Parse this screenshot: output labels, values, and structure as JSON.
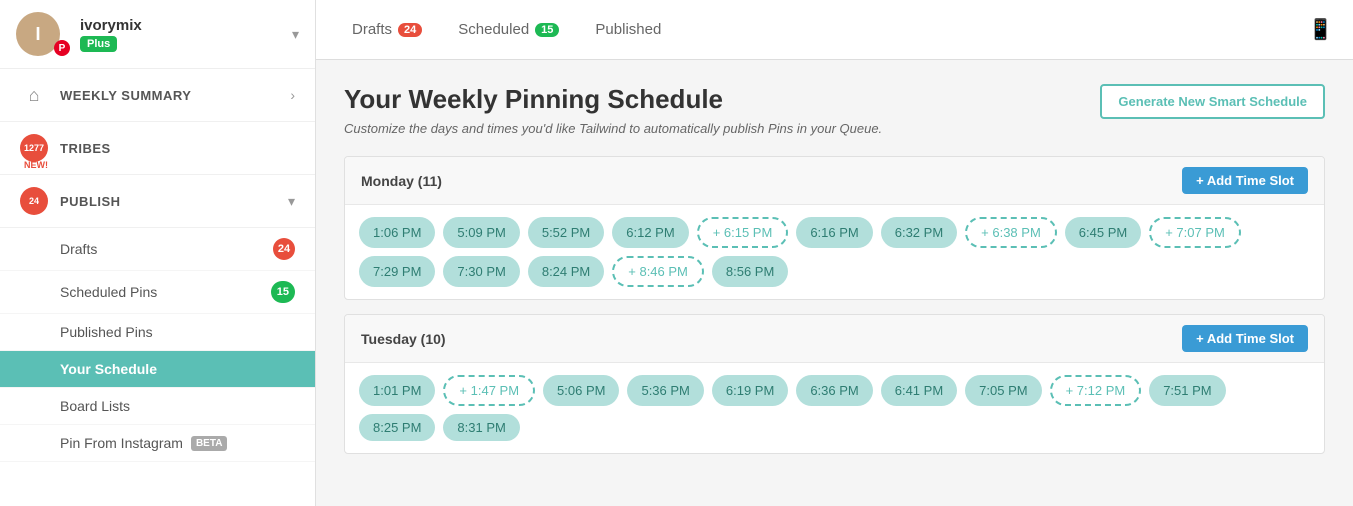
{
  "sidebar": {
    "user": {
      "name": "ivorymix",
      "plus_label": "Plus",
      "initials": "I"
    },
    "nav": [
      {
        "id": "weekly-summary",
        "label": "WEEKLY SUMMARY",
        "icon": "house",
        "badge": null
      },
      {
        "id": "tribes",
        "label": "TRIBES",
        "icon": "tribes-icon",
        "badge": "1277",
        "new": true
      },
      {
        "id": "publish",
        "label": "PUBLISH",
        "icon": "publish-icon",
        "badge": "24",
        "expandable": true
      }
    ],
    "sub_nav": [
      {
        "id": "drafts",
        "label": "Drafts",
        "badge": "24",
        "badge_type": "red"
      },
      {
        "id": "scheduled-pins",
        "label": "Scheduled Pins",
        "badge": "15",
        "badge_type": "green"
      },
      {
        "id": "published-pins",
        "label": "Published Pins",
        "badge": null
      },
      {
        "id": "your-schedule",
        "label": "Your Schedule",
        "active": true,
        "badge": null
      },
      {
        "id": "board-lists",
        "label": "Board Lists",
        "badge": null
      },
      {
        "id": "pin-from-instagram",
        "label": "Pin From Instagram",
        "badge": null,
        "beta": true
      }
    ]
  },
  "tabs": [
    {
      "id": "drafts",
      "label": "Drafts",
      "badge": "24",
      "badge_type": "red"
    },
    {
      "id": "scheduled",
      "label": "Scheduled",
      "badge": "15",
      "badge_type": "green"
    },
    {
      "id": "published",
      "label": "Published",
      "badge": null
    }
  ],
  "schedule": {
    "title": "Your Weekly Pinning Schedule",
    "subtitle": "Customize the days and times you'd like Tailwind to automatically publish Pins in your Queue.",
    "generate_btn": "Generate New Smart Schedule",
    "days": [
      {
        "id": "monday",
        "label": "Monday (11)",
        "add_slot": "+ Add Time Slot",
        "slots": [
          {
            "time": "1:06 PM",
            "dashed": false
          },
          {
            "time": "5:09 PM",
            "dashed": false
          },
          {
            "time": "5:52 PM",
            "dashed": false
          },
          {
            "time": "6:12 PM",
            "dashed": false
          },
          {
            "time": "+ 6:15 PM",
            "dashed": true
          },
          {
            "time": "6:16 PM",
            "dashed": false
          },
          {
            "time": "6:32 PM",
            "dashed": false
          },
          {
            "time": "+ 6:38 PM",
            "dashed": true
          },
          {
            "time": "6:45 PM",
            "dashed": false
          },
          {
            "time": "+ 7:07 PM",
            "dashed": true
          },
          {
            "time": "7:29 PM",
            "dashed": false
          },
          {
            "time": "7:30 PM",
            "dashed": false
          },
          {
            "time": "8:24 PM",
            "dashed": false
          },
          {
            "time": "+ 8:46 PM",
            "dashed": true
          },
          {
            "time": "8:56 PM",
            "dashed": false
          }
        ]
      },
      {
        "id": "tuesday",
        "label": "Tuesday (10)",
        "add_slot": "+ Add Time Slot",
        "slots": [
          {
            "time": "1:01 PM",
            "dashed": false
          },
          {
            "time": "+ 1:47 PM",
            "dashed": true
          },
          {
            "time": "5:06 PM",
            "dashed": false
          },
          {
            "time": "5:36 PM",
            "dashed": false
          },
          {
            "time": "6:19 PM",
            "dashed": false
          },
          {
            "time": "6:36 PM",
            "dashed": false
          },
          {
            "time": "6:41 PM",
            "dashed": false
          },
          {
            "time": "7:05 PM",
            "dashed": false
          },
          {
            "time": "+ 7:12 PM",
            "dashed": true
          },
          {
            "time": "7:51 PM",
            "dashed": false
          },
          {
            "time": "8:25 PM",
            "dashed": false
          },
          {
            "time": "8:31 PM",
            "dashed": false
          }
        ]
      }
    ]
  }
}
